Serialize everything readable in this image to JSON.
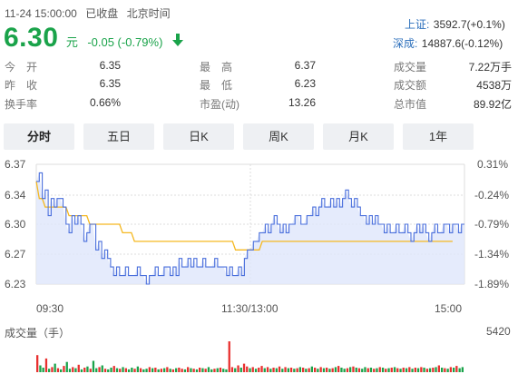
{
  "header": {
    "timestamp": "11-24 15:00:00",
    "market_status": "已收盘",
    "timezone": "北京时间",
    "price": "6.30",
    "unit": "元",
    "change": "-0.05 (-0.79%)",
    "direction_icon": "down-arrow-icon",
    "indices": [
      {
        "label": "上证:",
        "value": "3592.7(+0.1%)"
      },
      {
        "label": "深成:",
        "value": "14887.6(-0.12%)"
      }
    ]
  },
  "stats": {
    "col1": [
      {
        "label": "今　开",
        "value": "6.35"
      },
      {
        "label": "昨　收",
        "value": "6.35"
      },
      {
        "label": "换手率",
        "value": "0.66%"
      }
    ],
    "col2": [
      {
        "label": "最　高",
        "value": "6.37",
        "color": "#e8302f"
      },
      {
        "label": "最　低",
        "value": "6.23",
        "color": "#1aa34a"
      },
      {
        "label": "市盈(动)",
        "value": "13.26",
        "color": "#333333"
      }
    ],
    "col3": [
      {
        "label": "成交量",
        "value": "7.22万手"
      },
      {
        "label": "成交额",
        "value": "4538万"
      },
      {
        "label": "总市值",
        "value": "89.92亿"
      }
    ]
  },
  "tabs": [
    {
      "label": "分时",
      "active": true
    },
    {
      "label": "五日",
      "active": false
    },
    {
      "label": "日K",
      "active": false
    },
    {
      "label": "周K",
      "active": false
    },
    {
      "label": "月K",
      "active": false
    },
    {
      "label": "1年",
      "active": false
    }
  ],
  "chart_data": {
    "type": "line",
    "title": "",
    "x_ticks": [
      "09:30",
      "11:30/13:00",
      "15:00"
    ],
    "y_ticks_left": [
      "6.37",
      "6.34",
      "6.30",
      "6.27",
      "6.23"
    ],
    "y_ticks_right": [
      "0.31%",
      "-0.24%",
      "-0.79%",
      "-1.34%",
      "-1.89%"
    ],
    "ylim": [
      6.23,
      6.37
    ],
    "prev_close": 6.35,
    "colors": {
      "price": "#4a6fdc",
      "avg": "#f5b820",
      "fill": "#dfe6fb",
      "grid": "#dcdcdc",
      "vol_up": "#e8302f",
      "vol_down": "#1aa34a"
    },
    "series": [
      {
        "values": [
          6.35,
          6.36,
          6.33,
          6.34,
          6.31,
          6.33,
          6.32,
          6.33,
          6.33,
          6.32,
          6.3,
          6.29,
          6.31,
          6.3,
          6.31,
          6.3,
          6.28,
          6.29,
          6.3,
          6.3,
          6.27,
          6.28,
          6.26,
          6.27,
          6.26,
          6.25,
          6.24,
          6.25,
          6.24,
          6.24,
          6.25,
          6.24,
          6.24,
          6.24,
          6.25,
          6.24,
          6.24,
          6.23,
          6.24,
          6.24,
          6.25,
          6.24,
          6.24,
          6.25,
          6.25,
          6.24,
          6.25,
          6.24,
          6.26,
          6.25,
          6.25,
          6.26,
          6.25,
          6.26,
          6.25,
          6.25,
          6.26,
          6.25,
          6.25,
          6.25,
          6.26,
          6.25,
          6.25,
          6.25,
          6.24,
          6.25,
          6.24,
          6.24,
          6.25,
          6.24,
          6.26,
          6.27,
          6.27,
          6.28,
          6.28,
          6.29,
          6.29,
          6.3,
          6.29,
          6.3,
          6.31,
          6.3,
          6.29,
          6.3,
          6.29,
          6.3,
          6.3,
          6.31,
          6.31,
          6.3,
          6.3,
          6.31,
          6.31,
          6.32,
          6.31,
          6.32,
          6.33,
          6.32,
          6.32,
          6.33,
          6.32,
          6.33,
          6.32,
          6.33,
          6.34,
          6.33,
          6.32,
          6.33,
          6.32,
          6.31,
          6.31,
          6.3,
          6.31,
          6.3,
          6.31,
          6.3,
          6.3,
          6.29,
          6.3,
          6.29,
          6.29,
          6.3,
          6.29,
          6.29,
          6.3,
          6.29,
          6.28,
          6.29,
          6.3,
          6.29,
          6.3,
          6.29,
          6.28,
          6.29,
          6.3,
          6.29,
          6.29,
          6.3,
          6.3,
          6.29,
          6.3,
          6.3,
          6.29,
          6.3,
          6.3
        ]
      },
      {
        "values": [
          6.35,
          6.33,
          6.33,
          6.32,
          6.32,
          6.32,
          6.32,
          6.32,
          6.32,
          6.32,
          6.32,
          6.31,
          6.31,
          6.31,
          6.31,
          6.31,
          6.31,
          6.31,
          6.3,
          6.3,
          6.3,
          6.3,
          6.3,
          6.3,
          6.3,
          6.3,
          6.3,
          6.3,
          6.3,
          6.29,
          6.29,
          6.29,
          6.29,
          6.28,
          6.28,
          6.28,
          6.28,
          6.28,
          6.28,
          6.28,
          6.28,
          6.28,
          6.28,
          6.28,
          6.28,
          6.28,
          6.28,
          6.28,
          6.28,
          6.28,
          6.28,
          6.28,
          6.28,
          6.28,
          6.28,
          6.28,
          6.28,
          6.28,
          6.28,
          6.28,
          6.28,
          6.28,
          6.28,
          6.28,
          6.28,
          6.28,
          6.28,
          6.27,
          6.27,
          6.27,
          6.27,
          6.27,
          6.27,
          6.27,
          6.27,
          6.27,
          6.28,
          6.28,
          6.28,
          6.28,
          6.28,
          6.28,
          6.28,
          6.28,
          6.28,
          6.28,
          6.28,
          6.28,
          6.28,
          6.28,
          6.28,
          6.28,
          6.28,
          6.28,
          6.28,
          6.28,
          6.28,
          6.28,
          6.28,
          6.28,
          6.28,
          6.28,
          6.28,
          6.28,
          6.28,
          6.28,
          6.28,
          6.28,
          6.28,
          6.28,
          6.28,
          6.28,
          6.28,
          6.28,
          6.28,
          6.28,
          6.28,
          6.28,
          6.28,
          6.28,
          6.28,
          6.28,
          6.28,
          6.28,
          6.28,
          6.28,
          6.28,
          6.28,
          6.28,
          6.28,
          6.28,
          6.28,
          6.28,
          6.28,
          6.28,
          6.28,
          6.28,
          6.28,
          6.28,
          6.28,
          6.28
        ]
      }
    ],
    "volume": {
      "label": "成交量（手）",
      "max_label": "5420",
      "max": 5420,
      "values": [
        3000,
        1200,
        800,
        2400,
        600,
        900,
        1500,
        700,
        500,
        1100,
        1800,
        600,
        900,
        700,
        1300,
        500,
        800,
        1000,
        600,
        2000,
        700,
        900,
        1200,
        600,
        500,
        800,
        1100,
        700,
        600,
        900,
        700,
        500,
        800,
        600,
        1000,
        700,
        500,
        600,
        900,
        700,
        800,
        500,
        600,
        700,
        900,
        600,
        500,
        700,
        800,
        600,
        500,
        900,
        700,
        600,
        500,
        800,
        700,
        600,
        900,
        500,
        600,
        700,
        800,
        600,
        500,
        5420,
        900,
        700,
        1200,
        800,
        1500,
        1000,
        700,
        900,
        600,
        800,
        1100,
        700,
        900,
        600,
        800,
        700,
        1000,
        600,
        900,
        700,
        800,
        600,
        700,
        900,
        800,
        600,
        700,
        1000,
        800,
        600,
        900,
        700,
        800,
        600,
        700,
        900,
        1100,
        800,
        600,
        700,
        900,
        1000,
        800,
        700,
        600,
        900,
        700,
        800,
        600,
        700,
        900,
        800,
        600,
        700,
        800,
        900,
        700,
        600,
        800,
        700,
        900,
        600,
        800,
        700,
        900,
        800,
        600,
        700,
        800,
        900,
        1200,
        800,
        700,
        600,
        900,
        800,
        1100,
        700,
        900
      ],
      "up": [
        1,
        0,
        0,
        1,
        0,
        1,
        0,
        1,
        0,
        1,
        0,
        0,
        1,
        0,
        1,
        0,
        1,
        0,
        1,
        0,
        0,
        1,
        0,
        1,
        0,
        0,
        1,
        0,
        1,
        0,
        1,
        0,
        0,
        1,
        0,
        1,
        0,
        0,
        1,
        0,
        1,
        0,
        1,
        0,
        1,
        0,
        1,
        0,
        1,
        1,
        0,
        1,
        0,
        1,
        0,
        1,
        0,
        1,
        0,
        0,
        1,
        0,
        1,
        0,
        0,
        1,
        1,
        0,
        1,
        0,
        1,
        1,
        0,
        1,
        0,
        1,
        1,
        0,
        1,
        0,
        1,
        0,
        1,
        0,
        1,
        0,
        1,
        0,
        1,
        0,
        1,
        0,
        1,
        0,
        1,
        0,
        1,
        0,
        1,
        0,
        1,
        0,
        1,
        0,
        0,
        1,
        0,
        1,
        0,
        1,
        0,
        0,
        1,
        0,
        1,
        0,
        1,
        0,
        1,
        0,
        1,
        0,
        1,
        0,
        1,
        0,
        1,
        0,
        1,
        0,
        1,
        0,
        1,
        0,
        1,
        0,
        1,
        0,
        1,
        0,
        1,
        0,
        1
      ]
    }
  }
}
